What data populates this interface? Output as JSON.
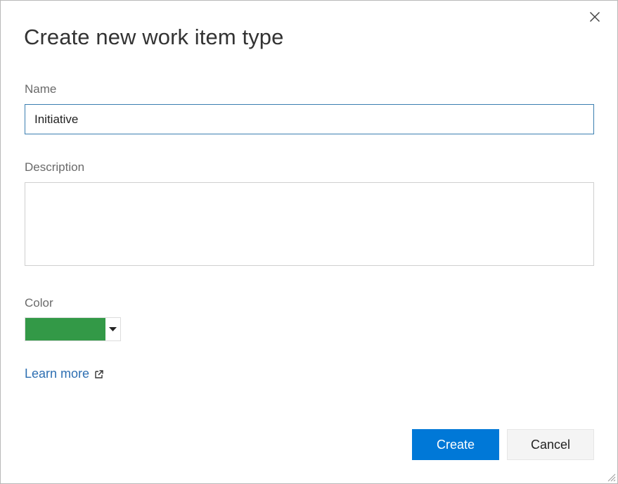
{
  "dialog": {
    "title": "Create new work item type",
    "close_icon": "close-icon"
  },
  "form": {
    "name_label": "Name",
    "name_value": "Initiative",
    "description_label": "Description",
    "description_value": "",
    "color_label": "Color",
    "color_value": "#339947",
    "color_caret_icon": "caret-down-icon"
  },
  "links": {
    "learn_more": "Learn more",
    "learn_more_icon": "external-link-icon"
  },
  "buttons": {
    "create": "Create",
    "cancel": "Cancel"
  },
  "colors": {
    "primary": "#0078d7",
    "link": "#2e6fb2",
    "focus_border": "#3b7fb0"
  }
}
